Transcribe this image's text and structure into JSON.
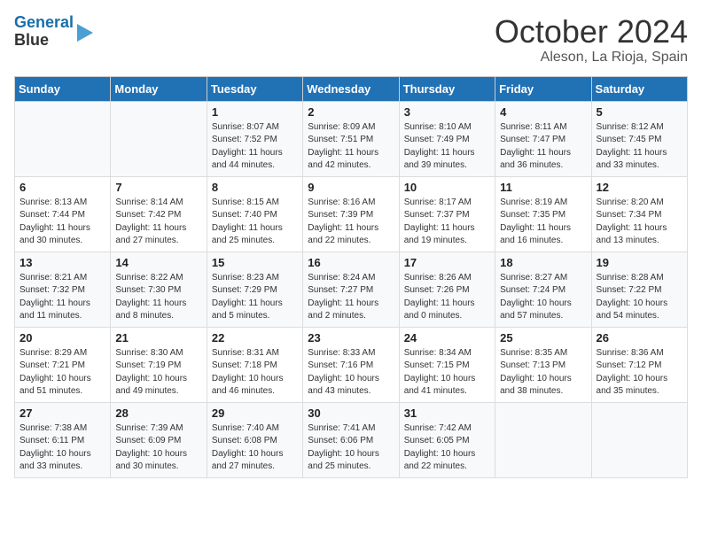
{
  "logo": {
    "line1": "General",
    "line2": "Blue"
  },
  "title": "October 2024",
  "location": "Aleson, La Rioja, Spain",
  "days_header": [
    "Sunday",
    "Monday",
    "Tuesday",
    "Wednesday",
    "Thursday",
    "Friday",
    "Saturday"
  ],
  "weeks": [
    [
      {
        "num": "",
        "info": ""
      },
      {
        "num": "",
        "info": ""
      },
      {
        "num": "1",
        "info": "Sunrise: 8:07 AM\nSunset: 7:52 PM\nDaylight: 11 hours and 44 minutes."
      },
      {
        "num": "2",
        "info": "Sunrise: 8:09 AM\nSunset: 7:51 PM\nDaylight: 11 hours and 42 minutes."
      },
      {
        "num": "3",
        "info": "Sunrise: 8:10 AM\nSunset: 7:49 PM\nDaylight: 11 hours and 39 minutes."
      },
      {
        "num": "4",
        "info": "Sunrise: 8:11 AM\nSunset: 7:47 PM\nDaylight: 11 hours and 36 minutes."
      },
      {
        "num": "5",
        "info": "Sunrise: 8:12 AM\nSunset: 7:45 PM\nDaylight: 11 hours and 33 minutes."
      }
    ],
    [
      {
        "num": "6",
        "info": "Sunrise: 8:13 AM\nSunset: 7:44 PM\nDaylight: 11 hours and 30 minutes."
      },
      {
        "num": "7",
        "info": "Sunrise: 8:14 AM\nSunset: 7:42 PM\nDaylight: 11 hours and 27 minutes."
      },
      {
        "num": "8",
        "info": "Sunrise: 8:15 AM\nSunset: 7:40 PM\nDaylight: 11 hours and 25 minutes."
      },
      {
        "num": "9",
        "info": "Sunrise: 8:16 AM\nSunset: 7:39 PM\nDaylight: 11 hours and 22 minutes."
      },
      {
        "num": "10",
        "info": "Sunrise: 8:17 AM\nSunset: 7:37 PM\nDaylight: 11 hours and 19 minutes."
      },
      {
        "num": "11",
        "info": "Sunrise: 8:19 AM\nSunset: 7:35 PM\nDaylight: 11 hours and 16 minutes."
      },
      {
        "num": "12",
        "info": "Sunrise: 8:20 AM\nSunset: 7:34 PM\nDaylight: 11 hours and 13 minutes."
      }
    ],
    [
      {
        "num": "13",
        "info": "Sunrise: 8:21 AM\nSunset: 7:32 PM\nDaylight: 11 hours and 11 minutes."
      },
      {
        "num": "14",
        "info": "Sunrise: 8:22 AM\nSunset: 7:30 PM\nDaylight: 11 hours and 8 minutes."
      },
      {
        "num": "15",
        "info": "Sunrise: 8:23 AM\nSunset: 7:29 PM\nDaylight: 11 hours and 5 minutes."
      },
      {
        "num": "16",
        "info": "Sunrise: 8:24 AM\nSunset: 7:27 PM\nDaylight: 11 hours and 2 minutes."
      },
      {
        "num": "17",
        "info": "Sunrise: 8:26 AM\nSunset: 7:26 PM\nDaylight: 11 hours and 0 minutes."
      },
      {
        "num": "18",
        "info": "Sunrise: 8:27 AM\nSunset: 7:24 PM\nDaylight: 10 hours and 57 minutes."
      },
      {
        "num": "19",
        "info": "Sunrise: 8:28 AM\nSunset: 7:22 PM\nDaylight: 10 hours and 54 minutes."
      }
    ],
    [
      {
        "num": "20",
        "info": "Sunrise: 8:29 AM\nSunset: 7:21 PM\nDaylight: 10 hours and 51 minutes."
      },
      {
        "num": "21",
        "info": "Sunrise: 8:30 AM\nSunset: 7:19 PM\nDaylight: 10 hours and 49 minutes."
      },
      {
        "num": "22",
        "info": "Sunrise: 8:31 AM\nSunset: 7:18 PM\nDaylight: 10 hours and 46 minutes."
      },
      {
        "num": "23",
        "info": "Sunrise: 8:33 AM\nSunset: 7:16 PM\nDaylight: 10 hours and 43 minutes."
      },
      {
        "num": "24",
        "info": "Sunrise: 8:34 AM\nSunset: 7:15 PM\nDaylight: 10 hours and 41 minutes."
      },
      {
        "num": "25",
        "info": "Sunrise: 8:35 AM\nSunset: 7:13 PM\nDaylight: 10 hours and 38 minutes."
      },
      {
        "num": "26",
        "info": "Sunrise: 8:36 AM\nSunset: 7:12 PM\nDaylight: 10 hours and 35 minutes."
      }
    ],
    [
      {
        "num": "27",
        "info": "Sunrise: 7:38 AM\nSunset: 6:11 PM\nDaylight: 10 hours and 33 minutes."
      },
      {
        "num": "28",
        "info": "Sunrise: 7:39 AM\nSunset: 6:09 PM\nDaylight: 10 hours and 30 minutes."
      },
      {
        "num": "29",
        "info": "Sunrise: 7:40 AM\nSunset: 6:08 PM\nDaylight: 10 hours and 27 minutes."
      },
      {
        "num": "30",
        "info": "Sunrise: 7:41 AM\nSunset: 6:06 PM\nDaylight: 10 hours and 25 minutes."
      },
      {
        "num": "31",
        "info": "Sunrise: 7:42 AM\nSunset: 6:05 PM\nDaylight: 10 hours and 22 minutes."
      },
      {
        "num": "",
        "info": ""
      },
      {
        "num": "",
        "info": ""
      }
    ]
  ]
}
